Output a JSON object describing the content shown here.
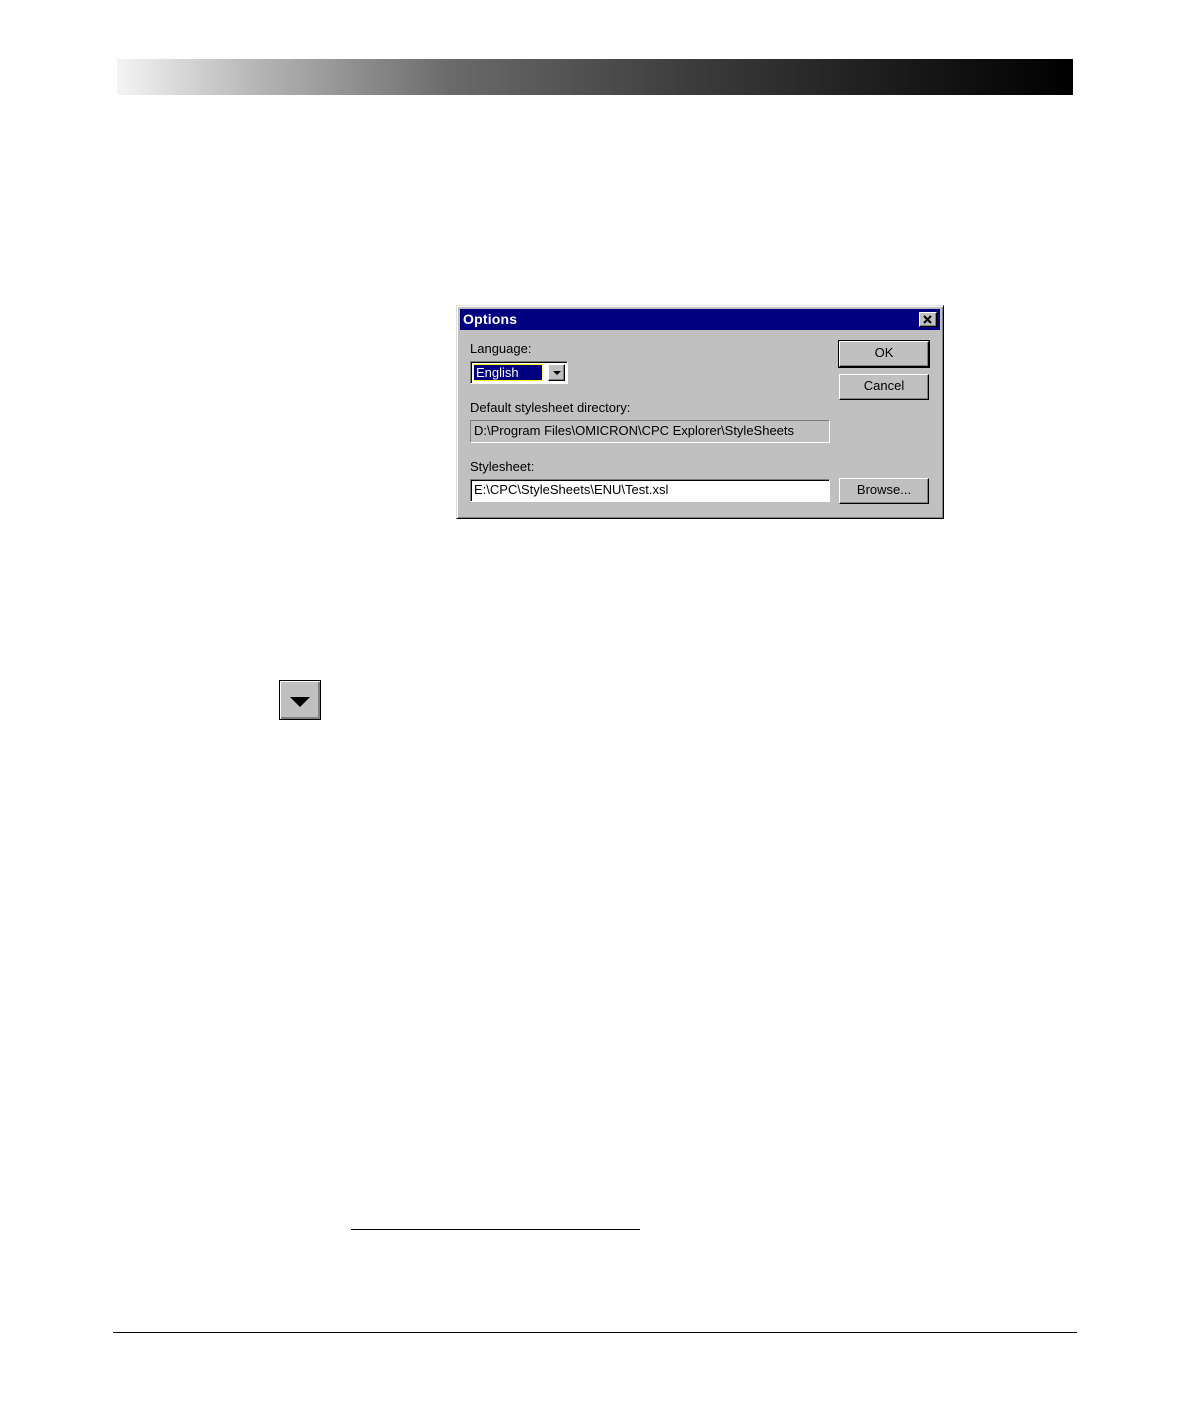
{
  "dialog": {
    "title": "Options",
    "language_label": "Language:",
    "language_value": "English",
    "default_dir_label": "Default stylesheet directory:",
    "default_dir_value": "D:\\Program Files\\OMICRON\\CPC Explorer\\StyleSheets",
    "stylesheet_label": "Stylesheet:",
    "stylesheet_value": "E:\\CPC\\StyleSheets\\ENU\\Test.xsl",
    "ok_label": "OK",
    "cancel_label": "Cancel",
    "browse_label": "Browse..."
  },
  "colors": {
    "titlebar": "#000080",
    "dialog_face": "#c0c0c0"
  },
  "icons": {
    "dropdown_button": "chevron-down-icon",
    "close": "close-icon"
  }
}
